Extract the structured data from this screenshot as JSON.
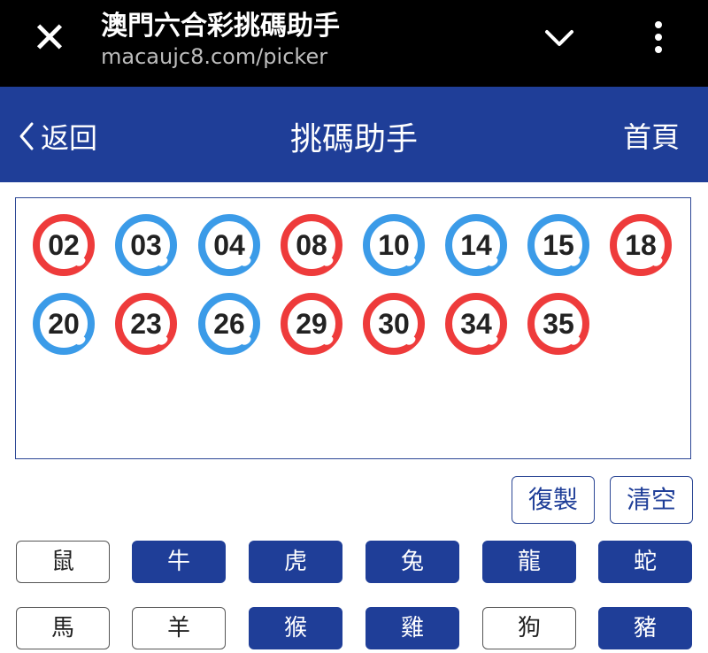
{
  "browser": {
    "title": "澳門六合彩挑碼助手",
    "url": "macaujc8.com/picker",
    "close_symbol": "✕"
  },
  "header": {
    "back_label": "返回",
    "title": "挑碼助手",
    "home_label": "首頁",
    "color": "#1f3e98"
  },
  "numbers": [
    {
      "value": "02",
      "color": "red"
    },
    {
      "value": "03",
      "color": "blue"
    },
    {
      "value": "04",
      "color": "blue"
    },
    {
      "value": "08",
      "color": "red"
    },
    {
      "value": "10",
      "color": "blue"
    },
    {
      "value": "14",
      "color": "blue"
    },
    {
      "value": "15",
      "color": "blue"
    },
    {
      "value": "18",
      "color": "red"
    },
    {
      "value": "20",
      "color": "blue"
    },
    {
      "value": "23",
      "color": "red"
    },
    {
      "value": "26",
      "color": "blue"
    },
    {
      "value": "29",
      "color": "red"
    },
    {
      "value": "30",
      "color": "red"
    },
    {
      "value": "34",
      "color": "red"
    },
    {
      "value": "35",
      "color": "red"
    }
  ],
  "actions": {
    "copy_label": "復製",
    "clear_label": "清空"
  },
  "zodiac": [
    {
      "label": "鼠",
      "selected": false
    },
    {
      "label": "牛",
      "selected": true
    },
    {
      "label": "虎",
      "selected": true
    },
    {
      "label": "兔",
      "selected": true
    },
    {
      "label": "龍",
      "selected": true
    },
    {
      "label": "蛇",
      "selected": true
    },
    {
      "label": "馬",
      "selected": false
    },
    {
      "label": "羊",
      "selected": false
    },
    {
      "label": "猴",
      "selected": true
    },
    {
      "label": "雞",
      "selected": true
    },
    {
      "label": "狗",
      "selected": false
    },
    {
      "label": "豬",
      "selected": true
    }
  ],
  "colors": {
    "red_ball": "#ee3b3b",
    "blue_ball": "#3b9be8",
    "brand": "#1f3e98"
  }
}
